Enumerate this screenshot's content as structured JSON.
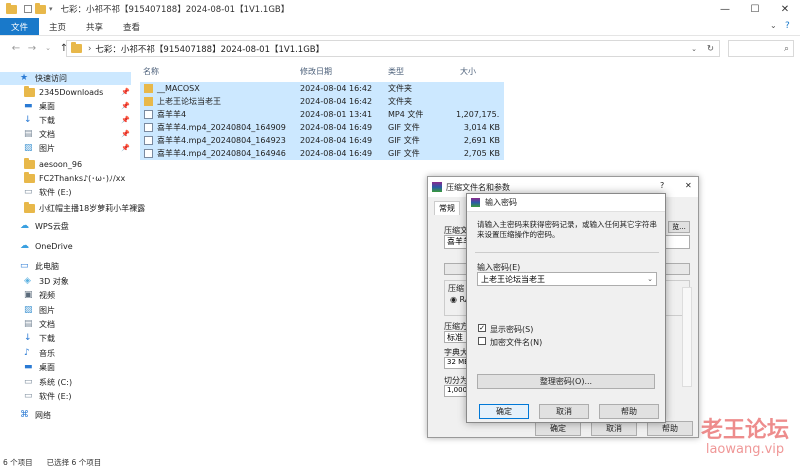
{
  "window": {
    "title": "七彩：小祁不祁【915407188】2024-08-01【1V1.1GB】",
    "minimize": "—",
    "maximize": "☐",
    "close": "✕"
  },
  "ribbon": {
    "tabs": [
      "文件",
      "主页",
      "共享",
      "查看"
    ],
    "help": "?"
  },
  "address": {
    "path": "七彩：小祁不祁【915407188】2024-08-01【1V1.1GB】",
    "search_icon": "⌕"
  },
  "nav": {
    "items": [
      {
        "label": "快速访问",
        "icon": "star-icon",
        "pinned": false
      },
      {
        "label": "2345Downloads",
        "icon": "folder-icon",
        "pinned": true
      },
      {
        "label": "桌面",
        "icon": "desktop-icon",
        "pinned": true
      },
      {
        "label": "下载",
        "icon": "download-icon",
        "pinned": true
      },
      {
        "label": "文档",
        "icon": "document-icon",
        "pinned": true
      },
      {
        "label": "图片",
        "icon": "picture-icon",
        "pinned": true
      },
      {
        "label": "aesoon_96",
        "icon": "folder-icon",
        "pinned": false
      },
      {
        "label": "FC2Thanks♪(･ω･)ﾉ/xx",
        "icon": "folder-icon",
        "pinned": false
      },
      {
        "label": "软件 (E:)",
        "icon": "drive-icon",
        "pinned": false
      },
      {
        "label": "小红帽主播18岁萝莉小羊裸露",
        "icon": "folder-icon",
        "pinned": false
      },
      {
        "label": "WPS云盘",
        "icon": "cloud-icon",
        "pinned": false
      },
      {
        "label": "OneDrive",
        "icon": "cloud-icon",
        "pinned": false
      },
      {
        "label": "此电脑",
        "icon": "computer-icon",
        "pinned": false
      },
      {
        "label": "3D 对象",
        "icon": "cube-icon",
        "pinned": false
      },
      {
        "label": "视频",
        "icon": "video-icon",
        "pinned": false
      },
      {
        "label": "图片",
        "icon": "picture-icon",
        "pinned": false
      },
      {
        "label": "文档",
        "icon": "document-icon",
        "pinned": false
      },
      {
        "label": "下载",
        "icon": "download-icon",
        "pinned": false
      },
      {
        "label": "音乐",
        "icon": "music-icon",
        "pinned": false
      },
      {
        "label": "桌面",
        "icon": "desktop-icon",
        "pinned": false
      },
      {
        "label": "系统 (C:)",
        "icon": "drive-icon",
        "pinned": false
      },
      {
        "label": "软件 (E:)",
        "icon": "drive-icon",
        "pinned": false
      },
      {
        "label": "网络",
        "icon": "network-icon",
        "pinned": false
      }
    ]
  },
  "filelist": {
    "columns": [
      "名称",
      "修改日期",
      "类型",
      "大小"
    ],
    "rows": [
      {
        "name": "__MACOSX",
        "date": "2024-08-04 16:42",
        "type": "文件夹",
        "size": ""
      },
      {
        "name": "上老王论坛当老王",
        "date": "2024-08-04 16:42",
        "type": "文件夹",
        "size": ""
      },
      {
        "name": "喜羊羊4",
        "date": "2024-08-01 13:41",
        "type": "MP4 文件",
        "size": "1,207,175..."
      },
      {
        "name": "喜羊羊4.mp4_20240804_164909",
        "date": "2024-08-04 16:49",
        "type": "GIF 文件",
        "size": "3,014 KB"
      },
      {
        "name": "喜羊羊4.mp4_20240804_164923",
        "date": "2024-08-04 16:49",
        "type": "GIF 文件",
        "size": "2,691 KB"
      },
      {
        "name": "喜羊羊4.mp4_20240804_164946",
        "date": "2024-08-04 16:49",
        "type": "GIF 文件",
        "size": "2,705 KB"
      }
    ]
  },
  "status": {
    "count": "6 个项目",
    "selected": "已选择 6 个项目"
  },
  "archive_dialog": {
    "title": "压缩文件名和参数",
    "help": "?",
    "close": "✕",
    "tab_general": "常规",
    "label_archive": "压缩文",
    "archive_value": "喜羊羊",
    "label_format": "压缩",
    "format_value": "RA",
    "label_method": "压缩方",
    "method_value": "标准",
    "label_dict": "字典大",
    "dict_value": "32 MB",
    "label_split": "切分为",
    "split_value": "1,000",
    "right_text": "览...",
    "ok": "确定",
    "cancel": "取消",
    "help_btn": "帮助"
  },
  "password_dialog": {
    "title": "输入密码",
    "info": "请输入主密码来获得密码记录，或输入任何其它字符串来设置压缩操作的密码。",
    "label_password": "输入密码(E)",
    "password_value": "上老王论坛当老王",
    "show_password": "显示密码(S)",
    "show_password_checked": true,
    "encrypt_names": "加密文件名(N)",
    "encrypt_names_checked": false,
    "organize": "整理密码(O)...",
    "ok": "确定",
    "cancel": "取消",
    "help": "帮助"
  },
  "watermark": {
    "cn": "老王论坛",
    "en": "laowang.vip"
  },
  "colors": {
    "accent": "#1979ca",
    "selection": "#cce8ff",
    "watermark": "#e03030"
  }
}
